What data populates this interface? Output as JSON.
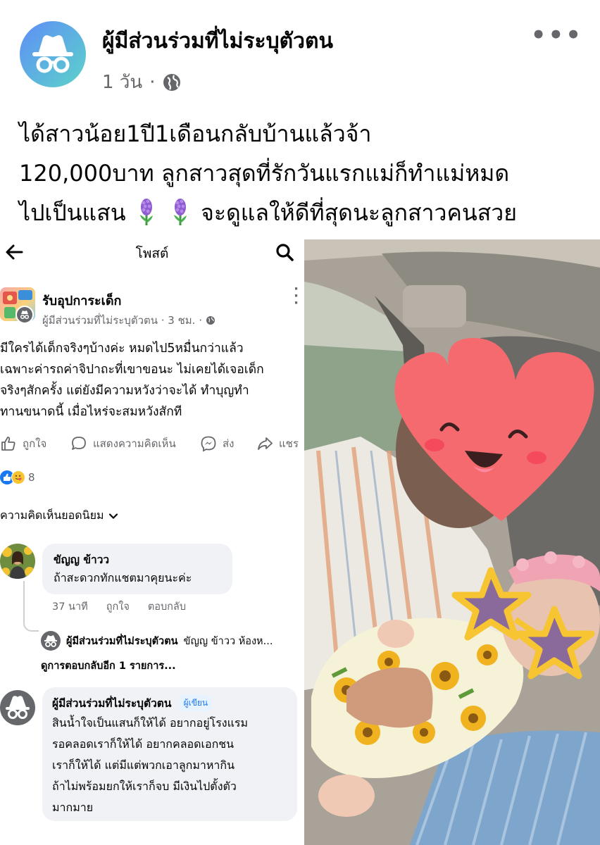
{
  "post": {
    "author": "ผู้มีส่วนร่วมที่ไม่ระบุตัวตน",
    "time": "1 วัน",
    "separator": "·",
    "more": "•••",
    "text_lines": [
      "ได้สาวน้อย1ปี1เดือนกลับบ้านแล้วจ้า",
      "120,000บาท ลูกสาวสุดที่รักวันแรกแม่ก็ทำแม่หมด",
      "ไปเป็นแสน",
      "จะดูแลให้ดีที่สุดนะลูกสาวคนสวย"
    ],
    "icons": [
      "anonymous-avatar-icon",
      "globe-icon",
      "hyacinth-emoji-icon"
    ]
  },
  "embed": {
    "header_title": "โพสต์",
    "group_name": "รับอุปการะเด็ก",
    "group_sub": "ผู้มีส่วนร่วมที่ไม่ระบุตัวตน · 3 ชม. ·",
    "body_lines": [
      "มีใครได้เด็กจริงๆบ้างค่ะ หมดไป5หมื่นกว่าแล้ว",
      "เฉพาะค่ารถค่าจิปาถะที่เขาขอนะ ไม่เคยได้เจอเด็ก",
      "จริงๆสักครั้ง แต่ยังมีความหวังว่าจะได้ ทำบุญทำ",
      "ทานขนาดนี้ เมื่อไหร่จะสมหวังสักที"
    ],
    "actions": {
      "like": "ถูกใจ",
      "comment": "แสดงความคิดเห็น",
      "send": "ส่ง",
      "share": "แชร"
    },
    "reaction_count": "8",
    "top_comments_label": "ความคิดเห็นยอดนิยม",
    "comment1": {
      "name": "ขัญญ ข้าวว",
      "text": "ถ้าสะดวกทักแชตมาคุยนะค่ะ",
      "time": "37 นาที",
      "like": "ถูกใจ",
      "reply": "ตอบกลับ"
    },
    "reply1": {
      "name": "ผู้มีส่วนร่วมที่ไม่ระบุตัวตน",
      "text": "ขัญญ ข้าวว ห้องห..."
    },
    "more_replies": "ดูการตอบกลับอีก 1 รายการ...",
    "comment2": {
      "name": "ผู้มีส่วนร่วมที่ไม่ระบุตัวตน",
      "badge": "ผู้เขียน",
      "text_lines": [
        "สินน้ำใจเป็นแสนก็ให้ได้ อยากอยู่โรงแรม",
        "รอคลอดเราก็ให้ได้ อยากคลอดเอกชน",
        "เราก็ให้ได้ แต่มีแต่พวกเอาลูกมาหากิน",
        "ถ้าไม่พร้อมยกให้เราก็จบ มีเงินไปตั้งตัว",
        "มากมาย"
      ]
    }
  },
  "colors": {
    "text": "#050505",
    "secondary": "#65676b",
    "bubble": "#f0f2f5",
    "link_blue": "#1877f2",
    "heart_sticker": "#f46a6e",
    "star_sticker": "#f7c531"
  }
}
